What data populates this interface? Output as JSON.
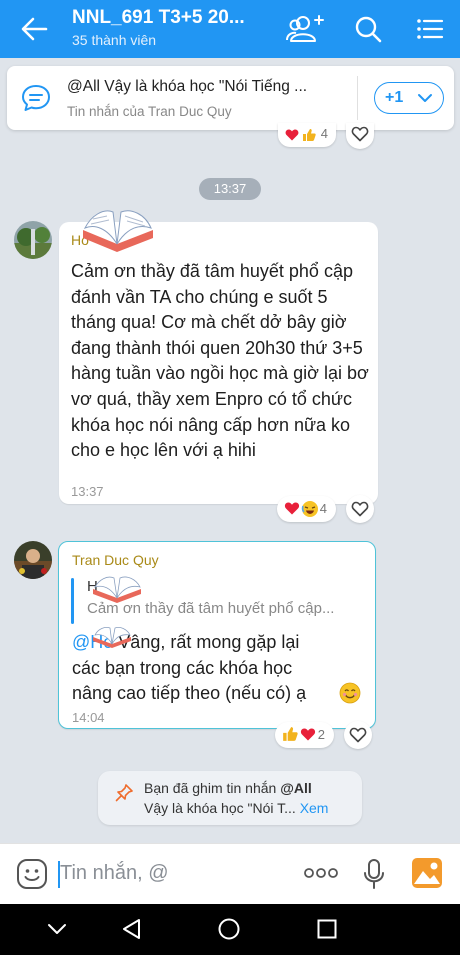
{
  "header": {
    "title": "NNL_691 T3+5 20...",
    "subtitle": "35 thành viên"
  },
  "pinned": {
    "title": "@All Vậy là khóa học \"Nói Tiếng ...",
    "subtitle": "Tin nhắn của Tran Duc Quy",
    "more_label": "+1"
  },
  "top_reactions": {
    "count": "4"
  },
  "time_divider": "13:37",
  "messages": [
    {
      "sender": "Ho",
      "text": "Cảm ơn thầy đã tâm huyết phổ cập đánh vần TA cho chúng e suốt 5 tháng qua! Cơ mà chết dở bây giờ đang thành thói quen 20h30 thứ 3+5 hàng tuần vào ngồi học mà giờ lại bơ vơ quá, thầy xem Enpro có tổ chức khóa học nói nâng cấp hơn nữa ko cho e học lên với ạ hihi",
      "time": "13:37",
      "reaction_count": "4"
    },
    {
      "sender": "Tran Duc Quy",
      "quote_name": "H",
      "quote_text": "Cảm ơn thầy đã tâm huyết phổ cập...",
      "mention": "@Ho",
      "text_line1": " Vâng, rất mong gặp lại",
      "text_line2": "các bạn trong các khóa học",
      "text_line3": "nâng cao tiếp theo (nếu có) ạ",
      "time": "14:04",
      "reaction_count": "2"
    }
  ],
  "system_notice": {
    "line1_prefix": "Bạn đã ghim tin nhắn ",
    "line1_bold": "@All",
    "line2_text": "Vậy là khóa học \"Nói T...",
    "line2_link": "Xem"
  },
  "input": {
    "placeholder": "Tin nhắn, @"
  },
  "colors": {
    "primary": "#2196f3",
    "sender_name": "#a98a18",
    "heart": "#e8203a"
  }
}
